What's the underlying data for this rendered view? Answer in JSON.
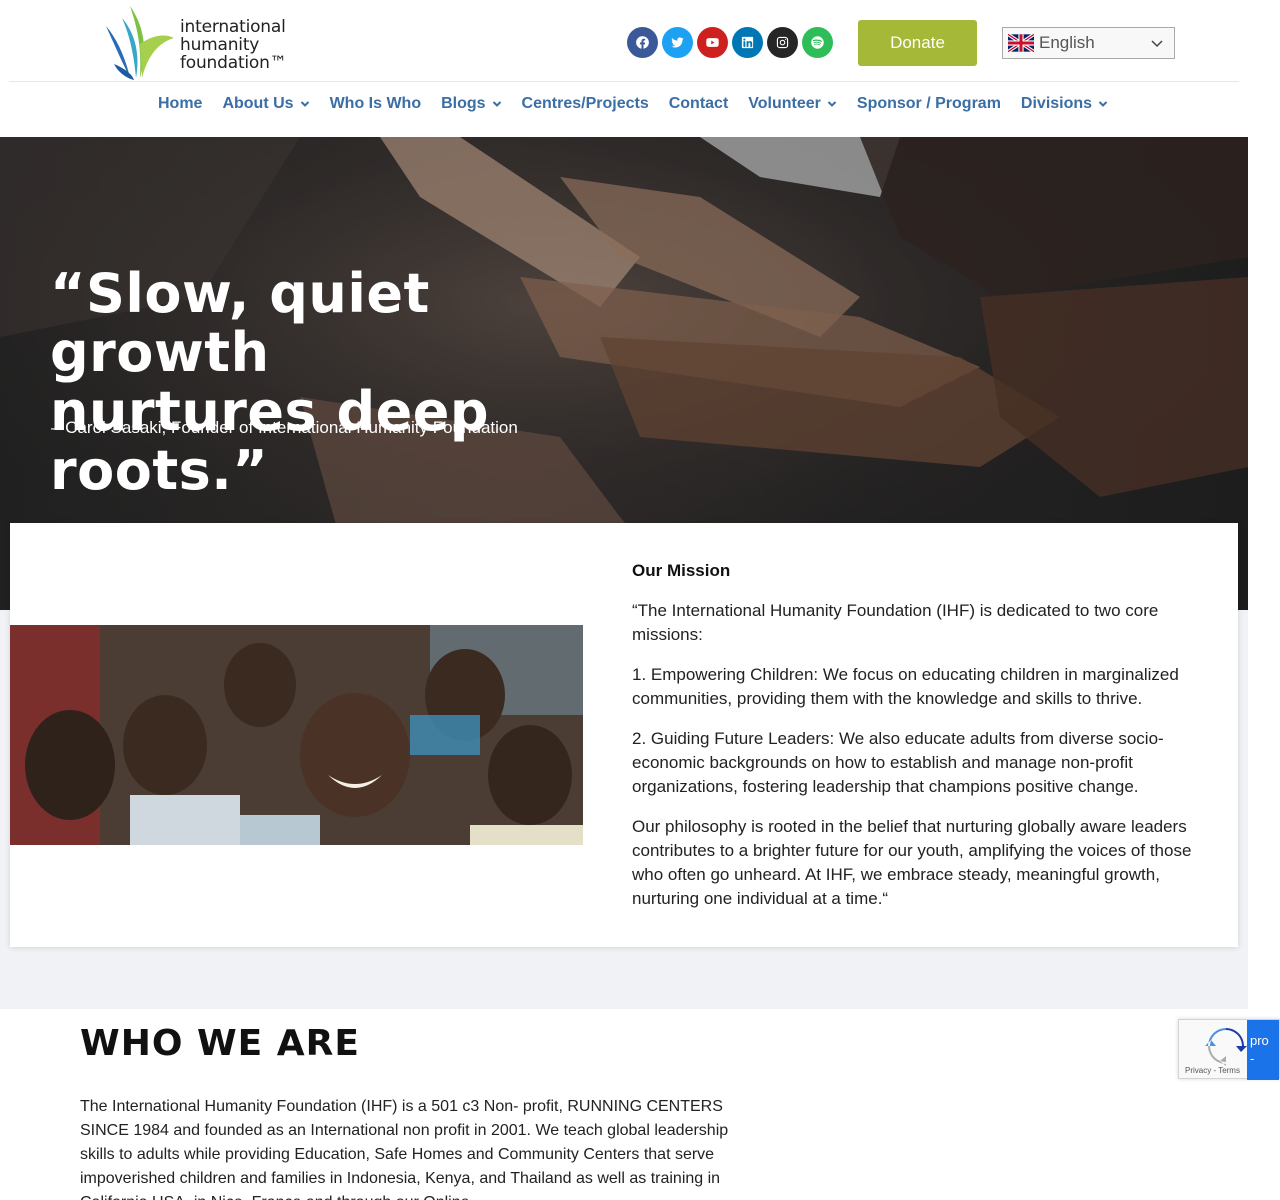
{
  "header": {
    "logo": {
      "line1": "international",
      "line2": "humanity",
      "line3": "foundation™"
    },
    "social": [
      {
        "name": "facebook-icon",
        "color": "#3b5998"
      },
      {
        "name": "twitter-icon",
        "color": "#1da1f2"
      },
      {
        "name": "youtube-icon",
        "color": "#cd201f"
      },
      {
        "name": "linkedin-icon",
        "color": "#0077b5"
      },
      {
        "name": "instagram-icon",
        "color": "#262626"
      },
      {
        "name": "spotify-icon",
        "color": "#2ebd59"
      }
    ],
    "donate_label": "Donate",
    "language": {
      "selected": "English",
      "flag": "uk-flag-icon"
    }
  },
  "nav": {
    "items": [
      {
        "label": "Home",
        "dropdown": false
      },
      {
        "label": "About Us",
        "dropdown": true
      },
      {
        "label": "Who Is Who",
        "dropdown": false
      },
      {
        "label": "Blogs",
        "dropdown": true
      },
      {
        "label": "Centres/Projects",
        "dropdown": false
      },
      {
        "label": "Contact",
        "dropdown": false
      },
      {
        "label": "Volunteer",
        "dropdown": true
      },
      {
        "label": "Sponsor / Program",
        "dropdown": false
      },
      {
        "label": "Divisions",
        "dropdown": true
      }
    ]
  },
  "hero": {
    "quote_line1": "“Slow, quiet growth",
    "quote_line2": "nurtures deep roots.”",
    "author": "– Carol Sasaki, Founder of International Humanity Foundation"
  },
  "mission": {
    "title": "Our Mission",
    "p1": "“The International Humanity Foundation (IHF) is dedicated to two core missions:",
    "p2": "1. Empowering Children: We focus on educating children in marginalized communities, providing them with the knowledge and skills to thrive.",
    "p3": "2. Guiding Future Leaders: We also educate adults from diverse socio-economic backgrounds on how to establish and manage non-profit organizations, fostering leadership that champions positive change.",
    "p4": "Our philosophy is rooted in the belief that nurturing globally aware leaders contributes to a brighter future for our youth, amplifying the voices of those who often go unheard. At IHF, we embrace steady, meaningful growth, nurturing one individual at a time.“"
  },
  "who": {
    "title": "WHO WE ARE",
    "text": "The International Humanity Foundation (IHF) is a 501 c3 Non- profit, RUNNING CENTERS SINCE 1984 and founded as an International non profit in 2001. We teach global leadership skills to adults while providing Education, Safe Homes and Community Centers that serve impoverished children and families in Indonesia, Kenya, and Thailand as well as training in California USA, in Nice, France and through our Online"
  },
  "recaptcha": {
    "links": "Privacy - Terms",
    "side_text": "pro",
    "side_text2": "-"
  },
  "colors": {
    "nav_link": "#3a6ea5",
    "donate": "#a6b837",
    "mission_bg": "#f0f2f5"
  }
}
